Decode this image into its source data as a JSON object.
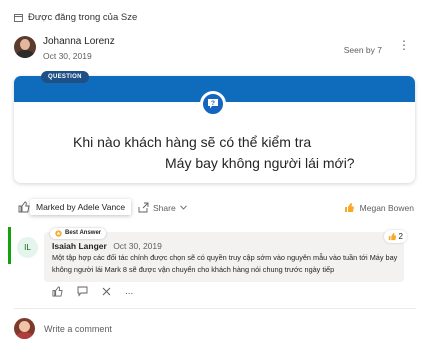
{
  "post": {
    "posted_in": "Được đăng trong của Sze",
    "author": "Johanna Lorenz",
    "date": "Oct 30, 2019",
    "seen_by": "Seen by 7",
    "more": "⋮"
  },
  "question": {
    "badge": "QUESTION",
    "line1": "Khi nào khách hàng sẽ có thể kiểm tra",
    "line2": "Máy bay không người lái mới?"
  },
  "actions": {
    "tooltip": "Marked by Adele Vance",
    "share_label": "Share",
    "liked_by": "Megan Bowen"
  },
  "answer": {
    "avatar_initials": "IL",
    "badge": "Best Answer",
    "author": "Isaiah Langer",
    "date": "Oct 30, 2019",
    "text": "Một tập hợp các đối tác chính được chọn sẽ có quyền truy cập sớm vào nguyên mẫu vào tuần tới Máy bay không người lái Mark 8 sẽ được vận chuyển cho khách hàng nói chung trước ngày tiếp",
    "reaction_count": "2",
    "more": "..."
  },
  "comment": {
    "placeholder": "Write a comment"
  },
  "colors": {
    "accent": "#0f6cbd",
    "badge_dark": "#1e5085",
    "best_answer_bar": "#13a10e",
    "reaction": "#f7a826"
  }
}
